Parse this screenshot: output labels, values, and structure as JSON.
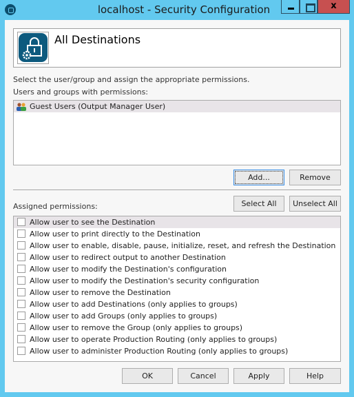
{
  "window": {
    "title": "localhost - Security Configuration",
    "close_label": "x"
  },
  "header": {
    "title": "All Destinations",
    "icon": "lock-gear-icon"
  },
  "instructions": "Select the user/group and assign the appropriate permissions.",
  "users_label": "Users and groups with permissions:",
  "users": [
    {
      "name": "Guest Users (Output Manager User)",
      "icon": "user-group-icon",
      "selected": true
    }
  ],
  "buttons": {
    "add": "Add...",
    "remove": "Remove",
    "select_all": "Select All",
    "unselect_all": "Unselect All",
    "ok": "OK",
    "cancel": "Cancel",
    "apply": "Apply",
    "help": "Help"
  },
  "permissions_label": "Assigned permissions:",
  "permissions": [
    {
      "label": "Allow user to see the Destination",
      "checked": false
    },
    {
      "label": "Allow user to print directly to the Destination",
      "checked": false
    },
    {
      "label": "Allow user to enable, disable, pause, initialize, reset, and refresh the Destination",
      "checked": false
    },
    {
      "label": "Allow user to redirect output to another Destination",
      "checked": false
    },
    {
      "label": "Allow user to modify the Destination's configuration",
      "checked": false
    },
    {
      "label": "Allow user to modify the Destination's security configuration",
      "checked": false
    },
    {
      "label": "Allow user to remove the Destination",
      "checked": false
    },
    {
      "label": "Allow user to add Destinations (only applies to groups)",
      "checked": false
    },
    {
      "label": "Allow user to add Groups (only applies to groups)",
      "checked": false
    },
    {
      "label": "Allow user to remove the Group (only applies to groups)",
      "checked": false
    },
    {
      "label": "Allow user to operate Production Routing (only applies to groups)",
      "checked": false
    },
    {
      "label": "Allow user to administer Production Routing (only applies to groups)",
      "checked": false
    }
  ]
}
